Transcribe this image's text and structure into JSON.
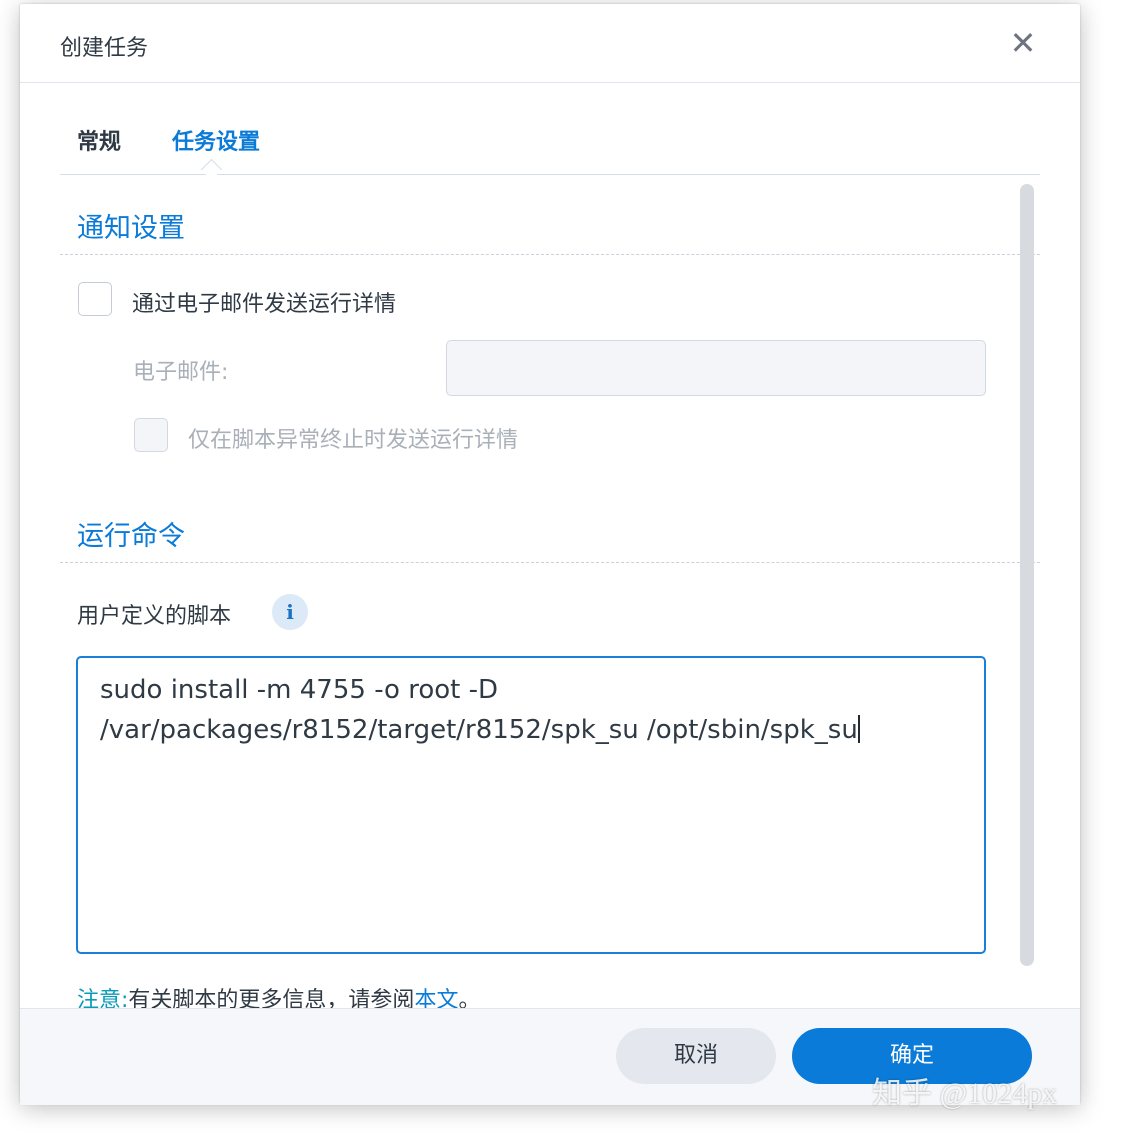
{
  "dialog": {
    "title": "创建任务",
    "close_glyph": "✕"
  },
  "tabs": [
    {
      "label": "常规",
      "active": false
    },
    {
      "label": "任务设置",
      "active": true
    }
  ],
  "notification": {
    "section_title": "通知设置",
    "email_checkbox_label": "通过电子邮件发送运行详情",
    "email_checked": false,
    "email_field_label": "电子邮件:",
    "email_value": "",
    "abnormal_checkbox_label": "仅在脚本异常终止时发送运行详情",
    "abnormal_checked": false
  },
  "run_command": {
    "section_title": "运行命令",
    "script_label": "用户定义的脚本",
    "info_glyph": "i",
    "script_lines": [
      "sudo install -m 4755 -o root -D",
      "/var/packages/r8152/target/r8152/spk_su /opt/sbin/spk_su"
    ]
  },
  "note": {
    "label": "注意:",
    "text": "有关脚本的更多信息，请参阅",
    "link": "本文",
    "end": "。"
  },
  "footer": {
    "cancel_label": "取消",
    "ok_label": "确定"
  },
  "watermark": "知乎 @1024px",
  "colors": {
    "accent": "#0a7bd8",
    "text": "#2f3a45",
    "muted": "#a9b0b8"
  }
}
